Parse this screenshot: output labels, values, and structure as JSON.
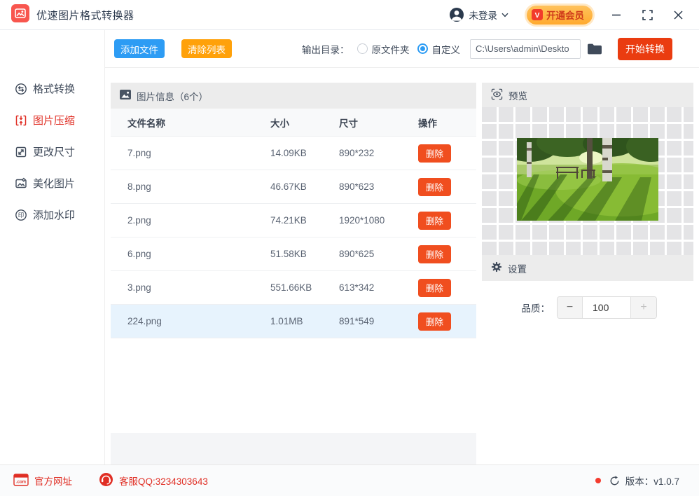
{
  "titlebar": {
    "app_title": "优速图片格式转换器",
    "login_label": "未登录",
    "vip_label": "开通会员"
  },
  "toolbar": {
    "add_files": "添加文件",
    "clear_list": "清除列表",
    "output_dir_label": "输出目录：",
    "output_options": [
      {
        "label": "原文件夹",
        "selected": false
      },
      {
        "label": "自定义",
        "selected": true
      }
    ],
    "path_value": "C:\\Users\\admin\\Deskto",
    "start_button": "开始转换"
  },
  "sidebar": {
    "items": [
      {
        "label": "格式转换",
        "active": false
      },
      {
        "label": "图片压缩",
        "active": true
      },
      {
        "label": "更改尺寸",
        "active": false
      },
      {
        "label": "美化图片",
        "active": false
      },
      {
        "label": "添加水印",
        "active": false
      }
    ]
  },
  "table": {
    "panel_title": "图片信息（6个）",
    "columns": [
      "文件名称",
      "大小",
      "尺寸",
      "操作"
    ],
    "delete_label": "删除",
    "rows": [
      {
        "name": "7.png",
        "size": "14.09KB",
        "dims": "890*232",
        "selected": false
      },
      {
        "name": "8.png",
        "size": "46.67KB",
        "dims": "890*623",
        "selected": false
      },
      {
        "name": "2.png",
        "size": "74.21KB",
        "dims": "1920*1080",
        "selected": false
      },
      {
        "name": "6.png",
        "size": "51.58KB",
        "dims": "890*625",
        "selected": false
      },
      {
        "name": "3.png",
        "size": "551.66KB",
        "dims": "613*342",
        "selected": false
      },
      {
        "name": "224.png",
        "size": "1.01MB",
        "dims": "891*549",
        "selected": true
      }
    ]
  },
  "preview": {
    "title": "预览"
  },
  "settings": {
    "title": "设置",
    "quality_label": "品质：",
    "quality_value": "100",
    "minus_label": "−",
    "plus_label": "+"
  },
  "footer": {
    "website_label": "官方网址",
    "qq_label": "客服QQ:3234303643",
    "version_label": "版本：v1.0.7"
  },
  "colors": {
    "accent_blue": "#2d9cf4",
    "accent_orange": "#ffa10a",
    "start_red": "#ea3c10",
    "delete_red": "#f04e1f",
    "sidebar_active_red": "#e02e24",
    "vip_pill_orange": "#ffb43a",
    "selected_row_bg": "#e7f3fd",
    "panel_header_gray": "#ececec",
    "footer_red": "#e02e24"
  }
}
